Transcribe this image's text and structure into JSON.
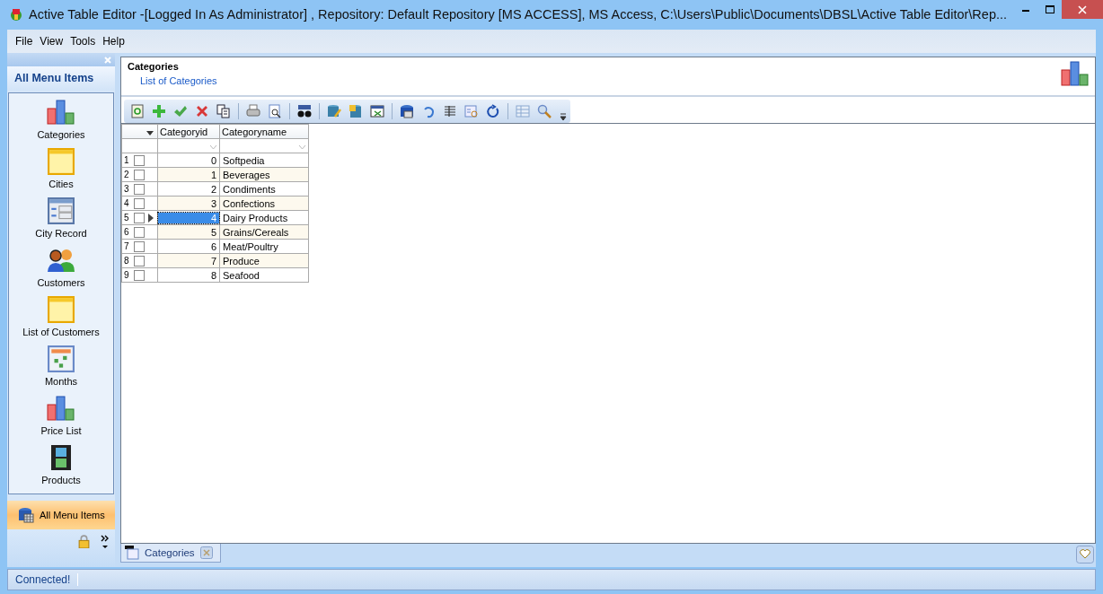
{
  "window": {
    "title": "Active Table Editor -[Logged In As Administrator] , Repository: Default Repository [MS ACCESS], MS Access, C:\\Users\\Public\\Documents\\DBSL\\Active Table Editor\\Rep..."
  },
  "menu": [
    "File",
    "View",
    "Tools",
    "Help"
  ],
  "sidebar": {
    "title": "All Menu Items",
    "items": [
      {
        "label": "Categories",
        "kind": "chart",
        "selected": false
      },
      {
        "label": "Cities",
        "kind": "note",
        "selected": false
      },
      {
        "label": "City Record",
        "kind": "form",
        "selected": false
      },
      {
        "label": "Customers",
        "kind": "people",
        "selected": false
      },
      {
        "label": "List of Customers",
        "kind": "note",
        "selected": false
      },
      {
        "label": "Months",
        "kind": "calendar",
        "selected": false
      },
      {
        "label": "Price List",
        "kind": "chart",
        "selected": false
      },
      {
        "label": "Products",
        "kind": "film",
        "selected": false
      }
    ],
    "groups": [
      {
        "label": "All Menu Items",
        "selected": true
      }
    ]
  },
  "header": {
    "title": "Categories",
    "subtitle": "List of Categories"
  },
  "table": {
    "columns": [
      "Categoryid",
      "Categoryname"
    ],
    "rows": [
      {
        "number": "1",
        "checked": false,
        "selected": false,
        "cells": [
          "0",
          "Softpedia"
        ]
      },
      {
        "number": "2",
        "checked": false,
        "selected": false,
        "cells": [
          "1",
          "Beverages"
        ]
      },
      {
        "number": "3",
        "checked": false,
        "selected": false,
        "cells": [
          "2",
          "Condiments"
        ]
      },
      {
        "number": "4",
        "checked": false,
        "selected": false,
        "cells": [
          "3",
          "Confections"
        ]
      },
      {
        "number": "5",
        "checked": false,
        "selected": true,
        "cells": [
          "4",
          "Dairy Products"
        ]
      },
      {
        "number": "6",
        "checked": false,
        "selected": false,
        "cells": [
          "5",
          "Grains/Cereals"
        ]
      },
      {
        "number": "7",
        "checked": false,
        "selected": false,
        "cells": [
          "6",
          "Meat/Poultry"
        ]
      },
      {
        "number": "8",
        "checked": false,
        "selected": false,
        "cells": [
          "7",
          "Produce"
        ]
      },
      {
        "number": "9",
        "checked": false,
        "selected": false,
        "cells": [
          "8",
          "Seafood"
        ]
      }
    ]
  },
  "tabs": [
    {
      "label": "Categories",
      "selected": true
    }
  ],
  "status_bar": "Connected!"
}
